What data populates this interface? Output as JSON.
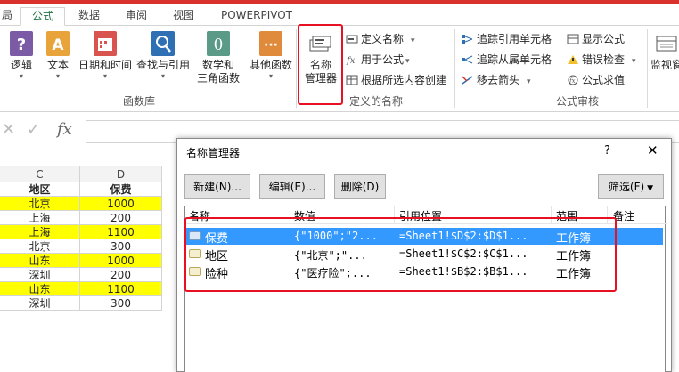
{
  "tabs": [
    {
      "label": "局"
    },
    {
      "label": "公式"
    },
    {
      "label": "数据"
    },
    {
      "label": "审阅"
    },
    {
      "label": "视图"
    },
    {
      "label": "POWERPIVOT"
    }
  ],
  "ribbon": {
    "function_library": {
      "label": "函数库",
      "buttons": [
        {
          "label": "逻辑",
          "color": "#7b5aa6"
        },
        {
          "label": "文本",
          "color": "#e8a33b"
        },
        {
          "label": "日期和时间",
          "color": "#d9534f"
        },
        {
          "label": "查找与引用",
          "color": "#2f6fb3"
        },
        {
          "label_line1": "数学和",
          "label_line2": "三角函数",
          "color": "#5a9a87"
        },
        {
          "label": "其他函数",
          "color": "#e08a3c"
        }
      ]
    },
    "defined_names": {
      "label": "定义的名称",
      "name_manager_line1": "名称",
      "name_manager_line2": "管理器",
      "items": [
        "定义名称",
        "用于公式",
        "根据所选内容创建"
      ]
    },
    "formula_auditing": {
      "label": "公式审核",
      "col1": [
        "追踪引用单元格",
        "追踪从属单元格",
        "移去箭头"
      ],
      "col2": [
        "显示公式",
        "错误检查",
        "公式求值"
      ],
      "watch": "监视窗"
    }
  },
  "formula_bar": {
    "cancel": "✕",
    "enter": "✓",
    "fx": "fx",
    "value": ""
  },
  "sheet": {
    "columns": [
      "C",
      "D"
    ],
    "headers": [
      "地区",
      "保费"
    ],
    "rows": [
      {
        "region": "北京",
        "premium": "1000",
        "highlight": true
      },
      {
        "region": "上海",
        "premium": "200",
        "highlight": false
      },
      {
        "region": "上海",
        "premium": "1100",
        "highlight": true
      },
      {
        "region": "北京",
        "premium": "300",
        "highlight": false
      },
      {
        "region": "山东",
        "premium": "1000",
        "highlight": true
      },
      {
        "region": "深圳",
        "premium": "200",
        "highlight": false
      },
      {
        "region": "山东",
        "premium": "1100",
        "highlight": true
      },
      {
        "region": "深圳",
        "premium": "300",
        "highlight": false
      }
    ]
  },
  "dialog": {
    "title": "名称管理器",
    "help": "?",
    "close": "✕",
    "buttons": {
      "new": "新建(N)...",
      "edit": "编辑(E)...",
      "delete": "删除(D)",
      "filter": "筛选(F)"
    },
    "columns": [
      "名称",
      "数值",
      "引用位置",
      "范围",
      "备注"
    ],
    "names": [
      {
        "name": "保费",
        "value": "{\"1000\";\"2...",
        "refers_to": "=Sheet1!$D$2:$D$1...",
        "scope": "工作簿",
        "selected": true
      },
      {
        "name": "地区",
        "value": "{\"北京\";\"...",
        "refers_to": "=Sheet1!$C$2:$C$1...",
        "scope": "工作簿",
        "selected": false
      },
      {
        "name": "险种",
        "value": "{\"医疗险\";...",
        "refers_to": "=Sheet1!$B$2:$B$1...",
        "scope": "工作簿",
        "selected": false
      }
    ]
  },
  "colors": {
    "accent_red": "#e81123",
    "excel_green": "#217346",
    "selection_blue": "#3399ff",
    "cell_yellow": "#ffff00"
  }
}
